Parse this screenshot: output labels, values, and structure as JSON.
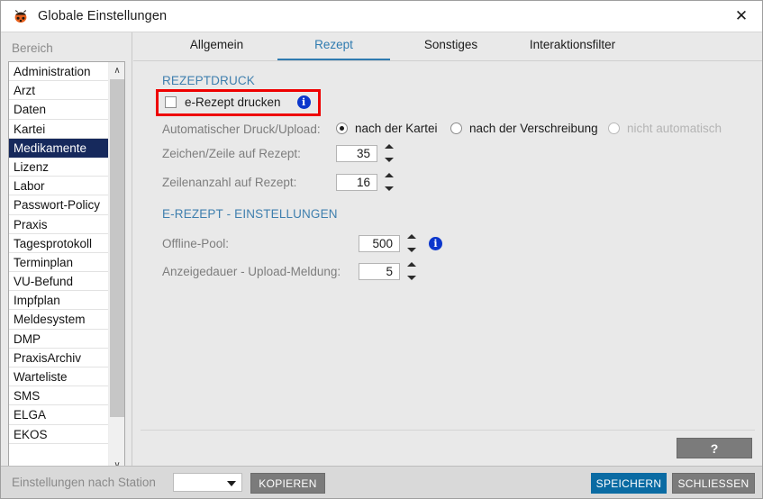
{
  "window": {
    "title": "Globale Einstellungen",
    "app_icon": "ladybug-icon",
    "close_label": "✕"
  },
  "sidebar": {
    "header": "Bereich",
    "items": [
      {
        "label": "Administration",
        "selected": false
      },
      {
        "label": "Arzt",
        "selected": false
      },
      {
        "label": "Daten",
        "selected": false
      },
      {
        "label": "Kartei",
        "selected": false
      },
      {
        "label": "Medikamente",
        "selected": true
      },
      {
        "label": "Lizenz",
        "selected": false
      },
      {
        "label": "Labor",
        "selected": false
      },
      {
        "label": "Passwort-Policy",
        "selected": false
      },
      {
        "label": "Praxis",
        "selected": false
      },
      {
        "label": "Tagesprotokoll",
        "selected": false
      },
      {
        "label": "Terminplan",
        "selected": false
      },
      {
        "label": "VU-Befund",
        "selected": false
      },
      {
        "label": "Impfplan",
        "selected": false
      },
      {
        "label": "Meldesystem",
        "selected": false
      },
      {
        "label": "DMP",
        "selected": false
      },
      {
        "label": "PraxisArchiv",
        "selected": false
      },
      {
        "label": "Warteliste",
        "selected": false
      },
      {
        "label": "SMS",
        "selected": false
      },
      {
        "label": "ELGA",
        "selected": false
      },
      {
        "label": "EKOS",
        "selected": false
      }
    ],
    "scroll_up_glyph": "∧",
    "scroll_down_glyph": "∨"
  },
  "tabs": [
    {
      "label": "Allgemein",
      "active": false
    },
    {
      "label": "Rezept",
      "active": true
    },
    {
      "label": "Sonstiges",
      "active": false
    },
    {
      "label": "Interaktionsfilter",
      "active": false
    }
  ],
  "rezeptdruck": {
    "section_title": "REZEPTDRUCK",
    "checkbox_label": "e-Rezept drucken",
    "checkbox_checked": false,
    "checkbox_info_icon": "info-icon",
    "auto_label": "Automatischer Druck/Upload:",
    "auto_options": [
      {
        "label": "nach der Kartei",
        "selected": true,
        "disabled": false
      },
      {
        "label": "nach der Verschreibung",
        "selected": false,
        "disabled": false
      },
      {
        "label": "nicht automatisch",
        "selected": false,
        "disabled": true
      }
    ],
    "chars_label": "Zeichen/Zeile auf Rezept:",
    "chars_value": "35",
    "lines_label": "Zeilenanzahl auf Rezept:",
    "lines_value": "16"
  },
  "erezept": {
    "section_title": "E-REZEPT - EINSTELLUNGEN",
    "offline_pool_label": "Offline-Pool:",
    "offline_pool_value": "500",
    "offline_pool_info_icon": "info-icon",
    "display_duration_label": "Anzeigedauer - Upload-Meldung:",
    "display_duration_value": "5"
  },
  "help_button": "?",
  "footer": {
    "station_label": "Einstellungen nach Station",
    "station_value": "",
    "copy_label": "KOPIEREN",
    "save_label": "SPEICHERN",
    "close_label": "SCHLIESSEN"
  },
  "colors": {
    "accent_blue": "#0a6ba3",
    "section_blue": "#3f7fae",
    "selection_navy": "#16295c",
    "highlight_red": "#ee0000",
    "info_blue": "#0b36cc",
    "button_grey": "#7b7b7b"
  }
}
